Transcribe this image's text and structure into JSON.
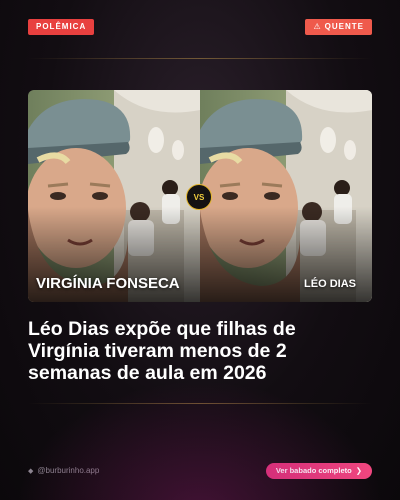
{
  "badges": {
    "category": "POLÊMICA",
    "hot_icon": "warning-icon",
    "hot": "QUENTE"
  },
  "comparison": {
    "left_name": "VIRGÍNIA FONSECA",
    "right_name": "LÉO DIAS",
    "vs_label": "VS"
  },
  "headline": "Léo Dias expõe que filhas de Virgínia tiveram menos de 2 semanas de aula em 2026",
  "footer": {
    "handle_icon": "diamond-icon",
    "handle": "@burburinho.app",
    "cta_label": "Ver babado completo",
    "cta_icon": "chevron-right-icon"
  },
  "colors": {
    "accent_red": "#e8403f",
    "cta_pink": "#e1337a",
    "vs_gold": "#e3b52c"
  }
}
